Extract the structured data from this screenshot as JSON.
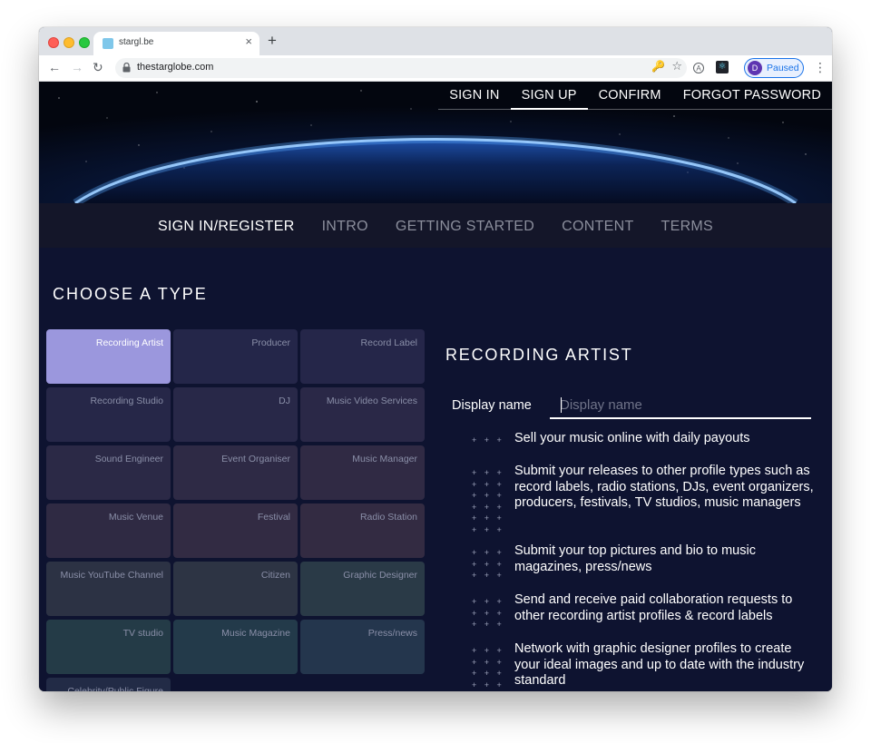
{
  "browser": {
    "tab_title": "stargl.be",
    "url": "thestarglobe.com",
    "profile_initial": "D",
    "profile_status": "Paused",
    "new_tab_symbol": "+",
    "close_symbol": "×"
  },
  "top_nav": {
    "items": [
      {
        "label": "SIGN IN",
        "active": false
      },
      {
        "label": "SIGN UP",
        "active": true
      },
      {
        "label": "CONFIRM",
        "active": false
      },
      {
        "label": "FORGOT PASSWORD",
        "active": false
      }
    ]
  },
  "main_nav": {
    "items": [
      {
        "label": "SIGN IN/REGISTER",
        "active": true
      },
      {
        "label": "INTRO",
        "active": false
      },
      {
        "label": "GETTING STARTED",
        "active": false
      },
      {
        "label": "CONTENT",
        "active": false
      },
      {
        "label": "TERMS",
        "active": false
      }
    ]
  },
  "choose_type": {
    "title": "CHOOSE A TYPE",
    "selected": "Recording Artist",
    "types": [
      {
        "label": "Recording Artist",
        "color": "#9b97dd"
      },
      {
        "label": "Producer",
        "color": "#242649"
      },
      {
        "label": "Record Label",
        "color": "#252649"
      },
      {
        "label": "Recording Studio",
        "color": "#262748"
      },
      {
        "label": "DJ",
        "color": "#282848"
      },
      {
        "label": "Music Video Services",
        "color": "#2a2847"
      },
      {
        "label": "Sound Engineer",
        "color": "#2b2946"
      },
      {
        "label": "Event Organiser",
        "color": "#2e2a45"
      },
      {
        "label": "Music Manager",
        "color": "#302a44"
      },
      {
        "label": "Music Venue",
        "color": "#2f2a43"
      },
      {
        "label": "Festival",
        "color": "#322b43"
      },
      {
        "label": "Radio Station",
        "color": "#332b42"
      },
      {
        "label": "Music YouTube Channel",
        "color": "#2c3244"
      },
      {
        "label": "Citizen",
        "color": "#2d3444"
      },
      {
        "label": "Graphic Designer",
        "color": "#2a3a47"
      },
      {
        "label": "TV studio",
        "color": "#243b47"
      },
      {
        "label": "Music Magazine",
        "color": "#233a4a"
      },
      {
        "label": "Press/news",
        "color": "#24364d"
      },
      {
        "label": "Celebrity/Public Figure",
        "color": "#222b46"
      }
    ]
  },
  "profile": {
    "title": "RECORDING ARTIST",
    "display_name_label": "Display name",
    "display_name_placeholder": "Display name",
    "display_name_value": "",
    "features": [
      {
        "text": "Sell your music online with daily payouts",
        "icon": "plus-grid-icon"
      },
      {
        "text": "Submit your releases to other profile types such as record labels, radio stations, DJs, event organizers, producers, festivals, TV studios, music managers",
        "icon": "plus-grid-icon"
      },
      {
        "text": "Submit your top pictures and bio to music magazines, press/news",
        "icon": "plus-grid-icon"
      },
      {
        "text": "Send and receive paid collaboration requests to other recording artist profiles & record labels",
        "icon": "plus-grid-icon"
      },
      {
        "text": "Network with graphic designer profiles to create your ideal images and up to date with the industry standard",
        "icon": "plus-grid-icon"
      }
    ]
  },
  "colors": {
    "page_bg": "#0e1330",
    "nav_bg": "#141629",
    "accent": "#9b97dd",
    "planet_glow": "#5aa8ff"
  }
}
